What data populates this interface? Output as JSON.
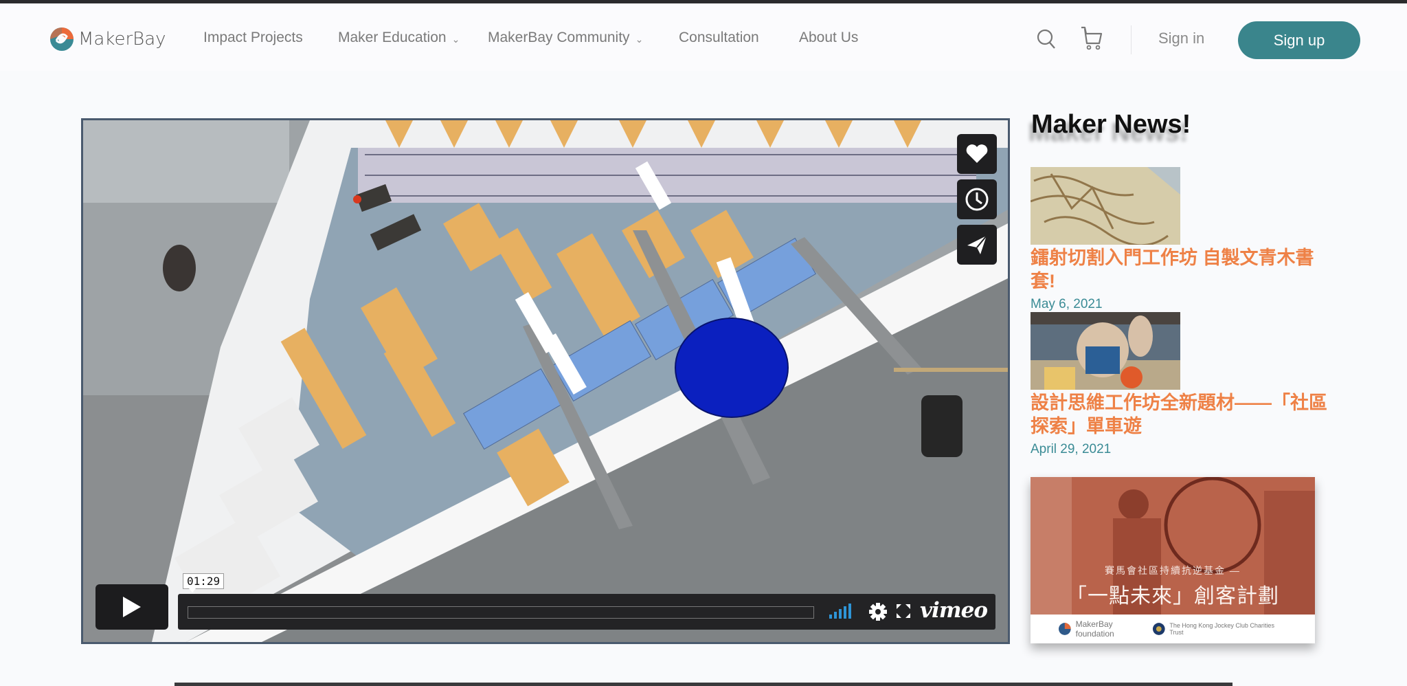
{
  "header": {
    "logo_text": "MakerBay",
    "nav": [
      {
        "label": "Impact Projects",
        "has_dropdown": false
      },
      {
        "label": "Maker Education",
        "has_dropdown": true
      },
      {
        "label": "MakerBay Community",
        "has_dropdown": true
      },
      {
        "label": "Consultation",
        "has_dropdown": false
      },
      {
        "label": "About Us",
        "has_dropdown": false
      }
    ],
    "icons": [
      "search-icon",
      "cart-icon"
    ],
    "signin_label": "Sign in",
    "signup_label": "Sign up",
    "accent_color": "#3a858c"
  },
  "video": {
    "timestamp": "01:29",
    "side_actions": [
      "like",
      "watch-later",
      "share"
    ],
    "brand": "vimeo",
    "volume_level": 1.0
  },
  "sidebar": {
    "title": "Maker News!",
    "items": [
      {
        "headline": "鐳射切割入門工作坊 自製文青木書套!",
        "date": "May 6, 2021"
      },
      {
        "headline": "設計思維工作坊全新題材——「社區探索」單車遊",
        "date": "April 29, 2021"
      }
    ],
    "banner": {
      "subtitle": "賽馬會社區持續抗逆基金 —",
      "title": "「一點未來」創客計劃",
      "org1": "MakerBay foundation",
      "org2": "The Hong Kong Jockey Club Charities Trust"
    },
    "headline_color": "#ee8146",
    "date_color": "#3a8b95"
  }
}
